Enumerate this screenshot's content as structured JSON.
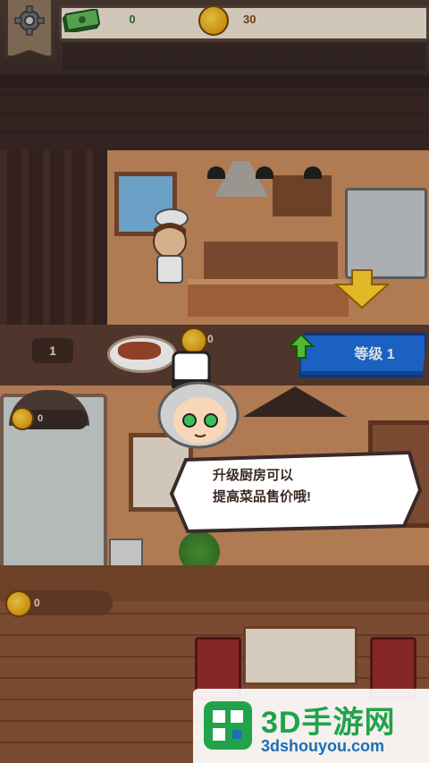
{
  "hud": {
    "cash_value": "0",
    "coin_value": "30"
  },
  "kitchen": {
    "stock_count": "1",
    "dish_coin_value": "0",
    "upgrade_button_label": "等级 1"
  },
  "elevator": {
    "coin_value": "0"
  },
  "bottom_counter": {
    "coin_value": "0"
  },
  "tutorial": {
    "line1": "升级厨房可以",
    "line2": "提高菜品售价哦!"
  },
  "watermark": {
    "title": "3D手游网",
    "url": "3dshouyou.com"
  },
  "colors": {
    "upgrade_button": "#1f6fdc",
    "coin": "#e6a010",
    "watermark_green": "#21a34a",
    "watermark_blue": "#1b6fb5"
  },
  "icons": [
    "gear-icon",
    "cash-icon",
    "coin-icon",
    "up-arrow-icon",
    "down-arrow-icon",
    "meat-plate-icon"
  ]
}
